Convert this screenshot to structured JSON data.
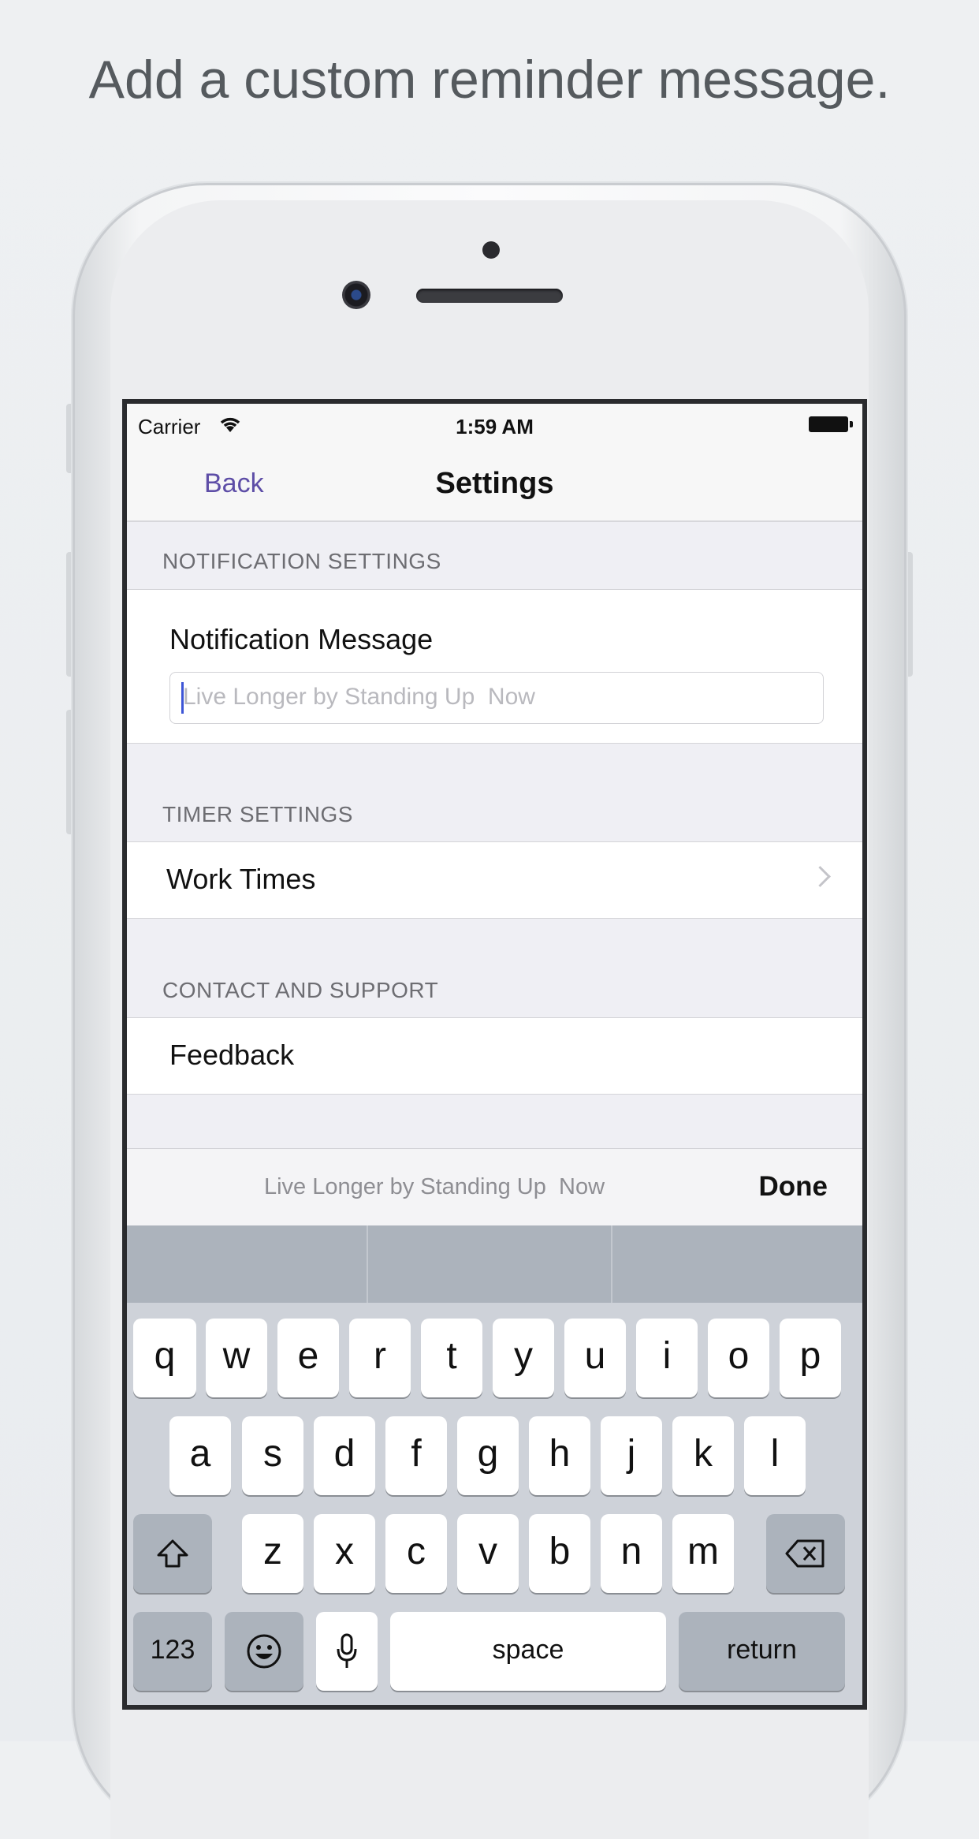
{
  "headline": "Add a custom reminder message.",
  "status_bar": {
    "carrier": "Carrier",
    "time": "1:59 AM"
  },
  "nav": {
    "back_label": "Back",
    "title": "Settings"
  },
  "sections": {
    "notification": {
      "header": "NOTIFICATION SETTINGS",
      "message_label": "Notification Message",
      "message_placeholder": "Live Longer by Standing Up  Now"
    },
    "timer": {
      "header": "TIMER SETTINGS",
      "work_times_label": "Work Times"
    },
    "contact": {
      "header": "CONTACT AND SUPPORT",
      "feedback_label": "Feedback"
    }
  },
  "toolbar": {
    "preview_text": "Live Longer by Standing Up  Now",
    "done_label": "Done"
  },
  "keyboard": {
    "row1": [
      "q",
      "w",
      "e",
      "r",
      "t",
      "y",
      "u",
      "i",
      "o",
      "p"
    ],
    "row2": [
      "a",
      "s",
      "d",
      "f",
      "g",
      "h",
      "j",
      "k",
      "l"
    ],
    "row3": [
      "z",
      "x",
      "c",
      "v",
      "b",
      "n",
      "m"
    ],
    "numbers_label": "123",
    "space_label": "space",
    "return_label": "return"
  },
  "colors": {
    "accent": "#5e4ea7",
    "caret": "#3d55d6"
  }
}
